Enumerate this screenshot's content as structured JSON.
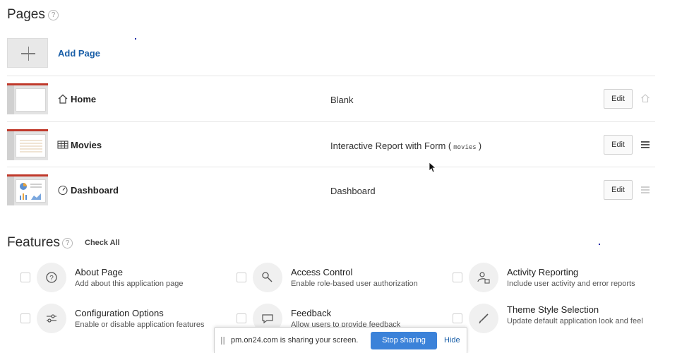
{
  "pages_section": {
    "title": "Pages",
    "help_icon": "help-circle-icon",
    "add_page_label": "Add Page",
    "rows": [
      {
        "name": "Home",
        "icon": "home-icon",
        "type": "Blank",
        "type_code": "",
        "edit_label": "Edit",
        "side_icon": "home-outline-icon"
      },
      {
        "name": "Movies",
        "icon": "table-icon",
        "type": "Interactive Report with Form (",
        "type_code": "movies",
        "type_suffix": ")",
        "edit_label": "Edit",
        "side_icon": "drag-handle-icon"
      },
      {
        "name": "Dashboard",
        "icon": "dashboard-gauge-icon",
        "type": "Dashboard",
        "type_code": "",
        "edit_label": "Edit",
        "side_icon": "drag-handle-icon"
      }
    ]
  },
  "features_section": {
    "title": "Features",
    "help_icon": "help-circle-icon",
    "check_all_label": "Check All",
    "items": [
      {
        "title": "About Page",
        "desc": "Add about this application page",
        "icon": "question-icon"
      },
      {
        "title": "Access Control",
        "desc": "Enable role-based user authorization",
        "icon": "key-icon"
      },
      {
        "title": "Activity Reporting",
        "desc": "Include user activity and error reports",
        "icon": "user-lock-icon"
      },
      {
        "title": "Configuration Options",
        "desc": "Enable or disable application features",
        "icon": "sliders-icon"
      },
      {
        "title": "Feedback",
        "desc": "Allow users to provide feedback",
        "icon": "speech-bubble-icon"
      },
      {
        "title": "Theme Style Selection",
        "desc": "Update default application look and feel",
        "icon": "brush-icon"
      }
    ]
  },
  "share_bar": {
    "message": "pm.on24.com is sharing your screen.",
    "stop_label": "Stop sharing",
    "hide_label": "Hide"
  },
  "colors": {
    "accent_blue": "#1a5fa8",
    "stop_button_blue": "#3b82d9",
    "thumb_red": "#c0392b"
  }
}
